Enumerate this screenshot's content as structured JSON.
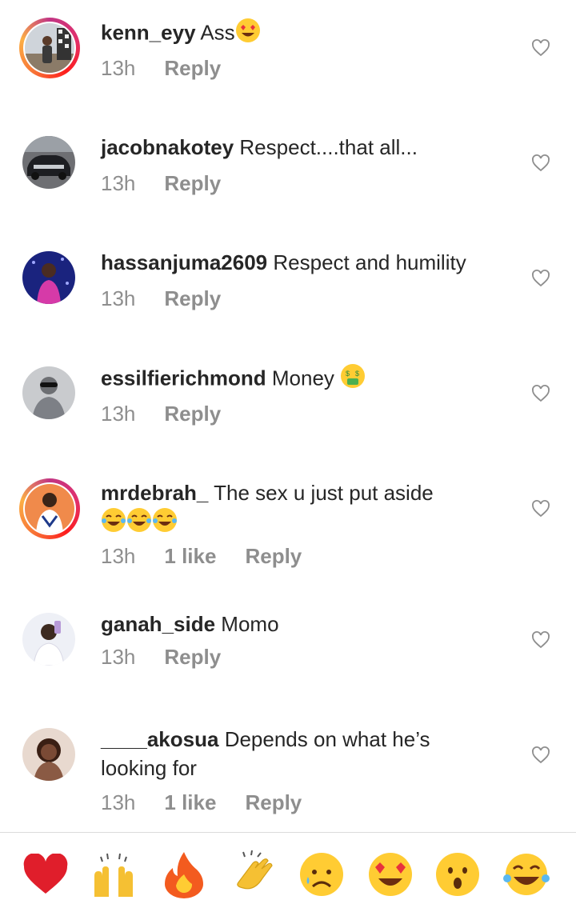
{
  "comments": [
    {
      "username": "kenn_eyy",
      "text": "Ass",
      "time": "13h",
      "likes": "",
      "reply": "Reply"
    },
    {
      "username": "jacobnakotey",
      "text": "Respect....that all...",
      "time": "13h",
      "likes": "",
      "reply": "Reply"
    },
    {
      "username": "hassanjuma2609",
      "text": "Respect and humility",
      "time": "13h",
      "likes": "",
      "reply": "Reply"
    },
    {
      "username": "essilfierichmond",
      "text": "Money",
      "time": "13h",
      "likes": "",
      "reply": "Reply"
    },
    {
      "username": "mrdebrah_",
      "text": "The sex u just put aside",
      "time": "13h",
      "likes": "1 like",
      "reply": "Reply"
    },
    {
      "username": "ganah_side",
      "text": "Momo",
      "time": "13h",
      "likes": "",
      "reply": "Reply"
    },
    {
      "username": "____akosua",
      "text": "Depends on what he’s looking for",
      "time": "13h",
      "likes": "1 like",
      "reply": "Reply"
    }
  ],
  "quick_reactions": [
    "red-heart",
    "raised-hands",
    "fire",
    "clapping-hands",
    "sad-face",
    "heart-eyes-face",
    "astonished-face",
    "tears-of-joy-face"
  ],
  "colors": {
    "text": "#262626",
    "meta": "#8e8e8e",
    "divider": "#dbdbdb"
  }
}
